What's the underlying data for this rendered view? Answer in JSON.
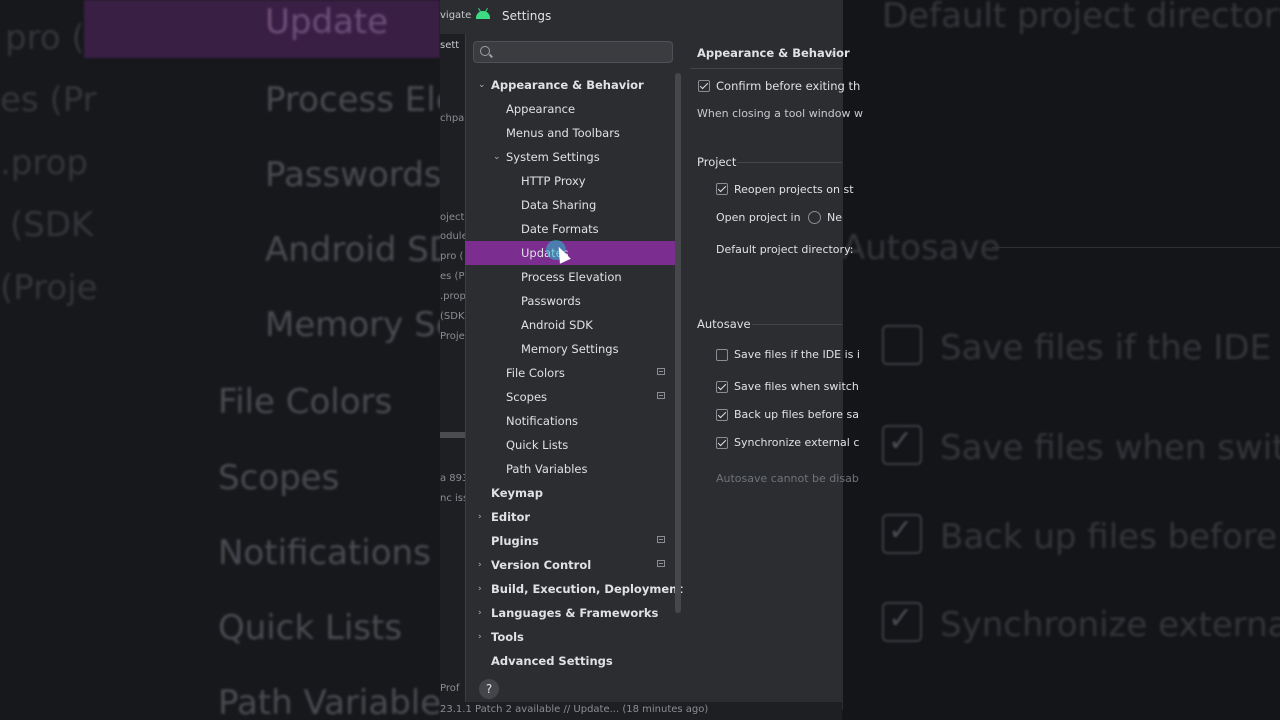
{
  "window": {
    "title": "Settings"
  },
  "background": {
    "left_fragments": [
      "pro (",
      "es (Pr",
      ".prop",
      "(SDK",
      "(Proje"
    ],
    "zoom_tree": [
      "Update",
      "Process Ele",
      "Passwords",
      "Android SD",
      "Memory Se",
      "File Colors",
      "Scopes",
      "Notifications",
      "Quick Lists",
      "Path Variables"
    ],
    "zoom_right": [
      "Default project directory:",
      "Autosave",
      "Save files if the IDE is i",
      "Save files when switch",
      "Back up files before sa",
      "Synchronize external c"
    ]
  },
  "ide_strip": {
    "nav": "vigate",
    "settings": "sett",
    "fragments": [
      "chpa",
      "oject",
      "odule",
      "pro (",
      "es (Pr",
      ".prop",
      "(SDK",
      "Proje",
      "a 893",
      "nc issu",
      "Prof"
    ],
    "status": "23.1.1 Patch 2 available // Update... (18 minutes ago)"
  },
  "search": {
    "placeholder": ""
  },
  "tree": {
    "appearance_behavior": "Appearance & Behavior",
    "appearance": "Appearance",
    "menus_toolbars": "Menus and Toolbars",
    "system_settings": "System Settings",
    "http_proxy": "HTTP Proxy",
    "data_sharing": "Data Sharing",
    "date_formats": "Date Formats",
    "updates": "Updates",
    "process_elevation": "Process Elevation",
    "passwords": "Passwords",
    "android_sdk": "Android SDK",
    "memory_settings": "Memory Settings",
    "file_colors": "File Colors",
    "scopes": "Scopes",
    "notifications": "Notifications",
    "quick_lists": "Quick Lists",
    "path_variables": "Path Variables",
    "keymap": "Keymap",
    "editor": "Editor",
    "plugins": "Plugins",
    "version_control": "Version Control",
    "build": "Build, Execution, Deployment",
    "languages": "Languages & Frameworks",
    "tools": "Tools",
    "advanced": "Advanced Settings"
  },
  "panel": {
    "breadcrumb": "Appearance & Behavior",
    "breadcrumb_sep": "›",
    "confirm_exit": "Confirm before exiting th",
    "closing_tool": "When closing a tool window w",
    "project_header": "Project",
    "reopen": "Reopen projects on st",
    "open_in": "Open project in",
    "open_in_option": "Ne",
    "default_dir": "Default project directory:",
    "autosave_header": "Autosave",
    "save_idle": "Save files if the IDE is i",
    "save_switch": "Save files when switch",
    "backup": "Back up files before sa",
    "sync": "Synchronize external c",
    "autosave_note": "Autosave cannot be disab"
  },
  "help": {
    "label": "?"
  }
}
